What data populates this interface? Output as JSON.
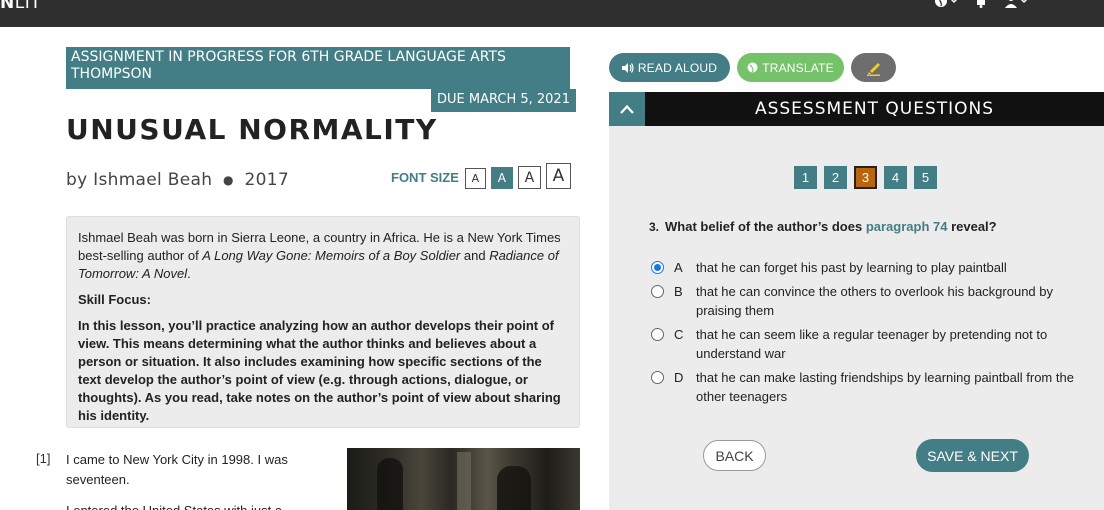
{
  "topbar": {
    "logo_bold": "N",
    "logo_rest": "LIT",
    "icons": [
      "globe-icon",
      "bell-icon",
      "user-icon"
    ]
  },
  "assignment": {
    "banner": "ASSIGNMENT IN PROGRESS FOR 6TH GRADE LANGUAGE ARTS THOMPSON",
    "due": "DUE MARCH 5, 2021"
  },
  "article": {
    "title": "UNUSUAL NORMALITY",
    "author": "by Ishmael Beah",
    "year": "2017",
    "font_size_label": "FONT SIZE",
    "font_size_options": [
      "A",
      "A",
      "A",
      "A"
    ]
  },
  "intro": {
    "bio_start": "Ishmael Beah was born in Sierra Leone, a country in Africa. He is a New York Times best-selling author of ",
    "book1": "A Long Way Gone: Memoirs of a Boy Soldier",
    "bio_and": " and ",
    "book2": "Radiance of Tomorrow: A Novel",
    "bio_end": ".",
    "skill_label": "Skill Focus:",
    "lesson": "In this lesson, you’ll practice analyzing how an author develops their point of view. This means determining what the author thinks and believes about a person or situation. It also includes examining how specific sections of the text develop the author’s point of view (e.g. through actions, dialogue, or thoughts). As you read, take notes on the author’s point of view about sharing his identity."
  },
  "passage": {
    "para_num": "[1]",
    "line1": "I came to New York City in 1998. I was seventeen.",
    "line2": "I entered the United States with just a"
  },
  "tools": {
    "read_aloud": "READ ALOUD",
    "translate": "TRANSLATE"
  },
  "assessment": {
    "header": "ASSESSMENT QUESTIONS",
    "numbers": [
      "1",
      "2",
      "3",
      "4",
      "5"
    ],
    "current": 3,
    "question_num": "3.",
    "question_pre": "What belief of the author’s does ",
    "question_link": "paragraph 74",
    "question_post": " reveal?",
    "options": [
      {
        "letter": "A",
        "text": "that he can forget his past by learning to play paintball"
      },
      {
        "letter": "B",
        "text": "that he can convince the others to overlook his background by praising them"
      },
      {
        "letter": "C",
        "text": "that he can seem like a regular teenager by pretending not to understand war"
      },
      {
        "letter": "D",
        "text": "that he can make lasting friendships by learning paintball from the other teenagers"
      }
    ],
    "selected": "A",
    "back": "BACK",
    "save_next": "SAVE & NEXT"
  },
  "colors": {
    "teal": "#437d85",
    "green": "#76c26a",
    "current_question": "#b8650d",
    "topbar": "#2f2f2f"
  }
}
